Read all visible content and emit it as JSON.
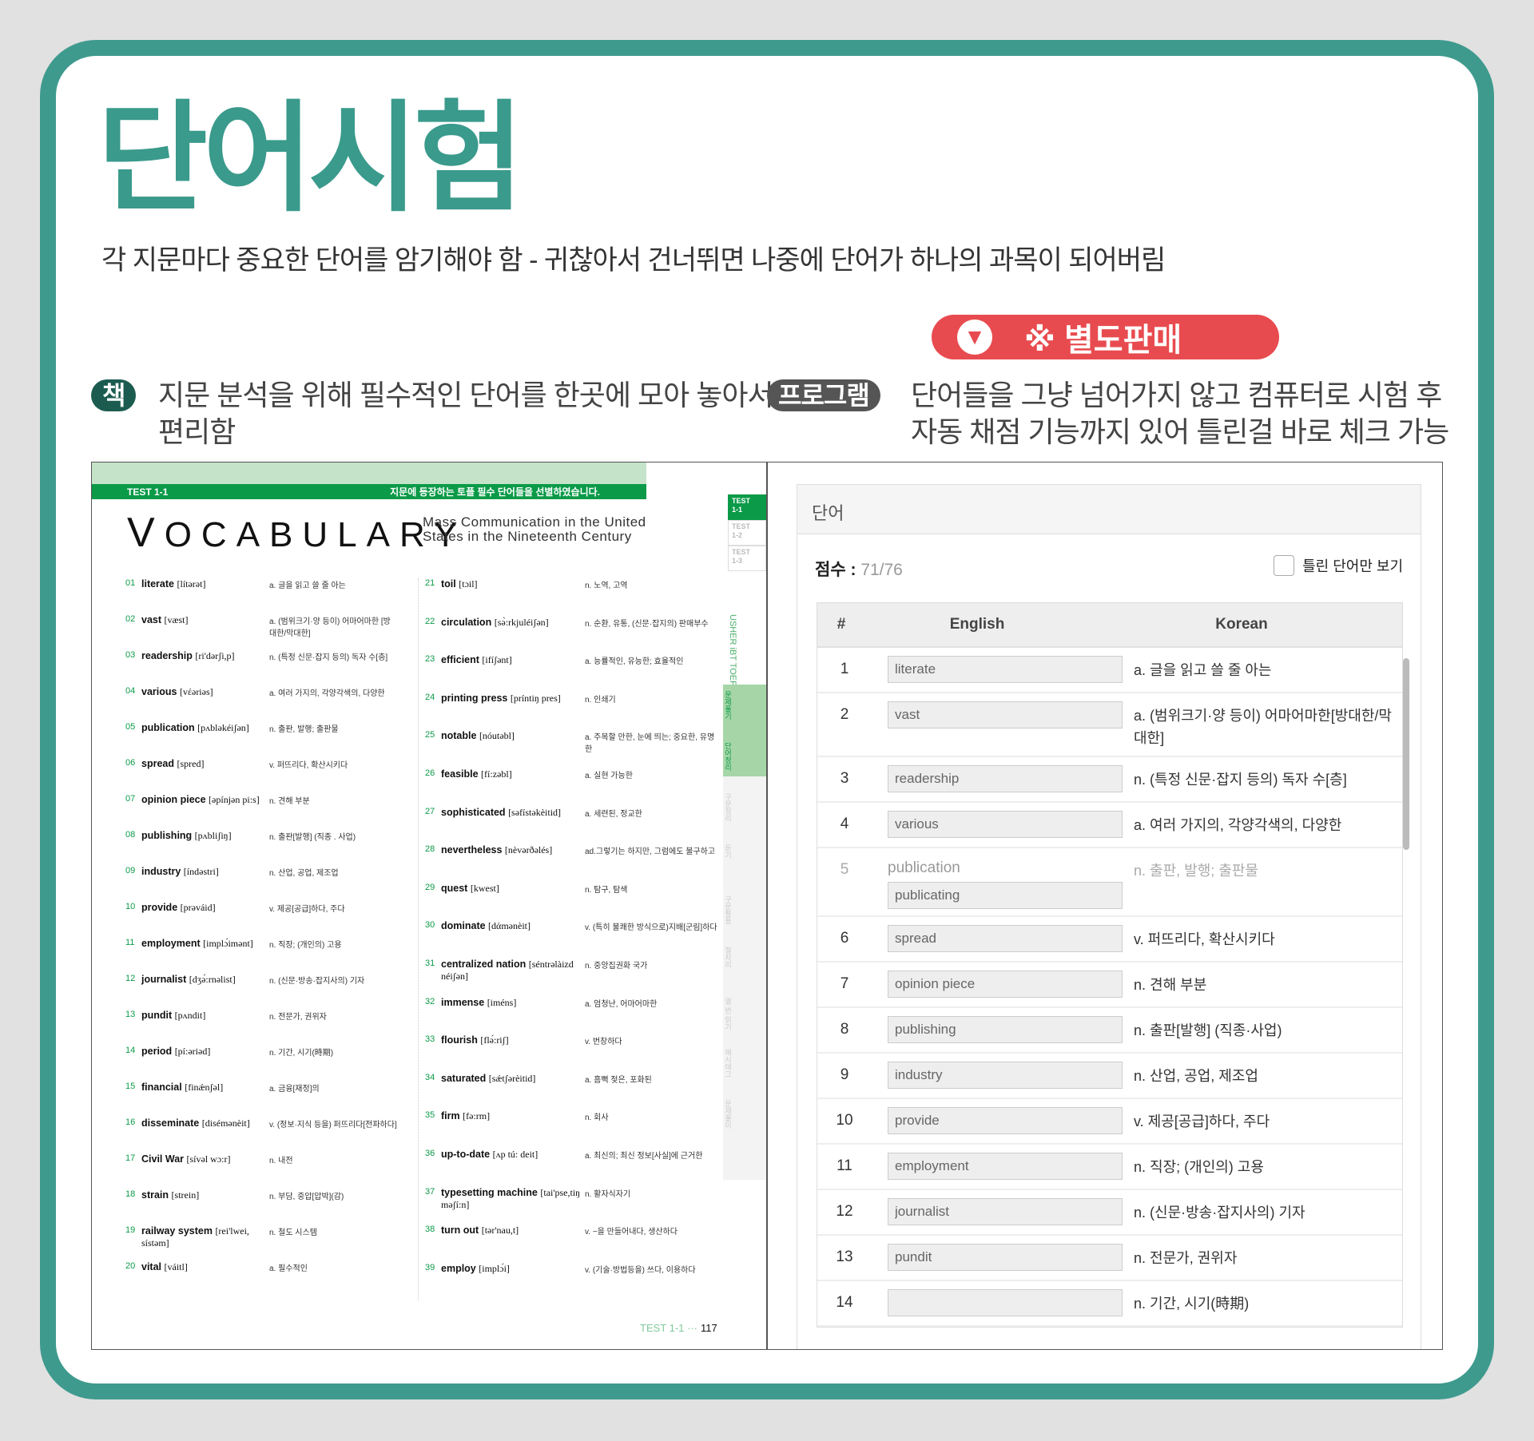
{
  "title": "단어시험",
  "subtitle": "각 지문마다 중요한 단어를 암기해야 함 - 귀찮아서 건너뛰면 나중에 단어가 하나의 과목이 되어버림",
  "sale_badge": {
    "label": "※ 별도판매",
    "icon": "down-arrow-icon",
    "color": "#e84b4f"
  },
  "book_desc": {
    "pill": "책",
    "text": "지문 분석을 위해 필수적인 단어를 한곳에 모아 놓아서 보기 편리함"
  },
  "program_desc": {
    "pill": "프로그램",
    "text": "단어들을 그냥 넘어가지 않고 컴퓨터로 시험 후 자동 채점 기능까지 있어 틀린걸 바로 체크 가능"
  },
  "book": {
    "band_left": "TEST 1-1",
    "band_right": "지문에 등장하는 토플 필수 단어들을 선별하였습니다.",
    "heading": "VOCABULARY",
    "passage_title": "Mass Communication in the United States in the Nineteenth Century",
    "tabs": [
      {
        "top": "TEST",
        "bottom": "1-1"
      },
      {
        "top": "TEST",
        "bottom": "1-2"
      },
      {
        "top": "TEST",
        "bottom": "1-3"
      }
    ],
    "series": "USHER iBT TOEFL BASIC READING",
    "steps": [
      "문제풀기",
      "단어정리",
      "구문정리",
      "듣기",
      "구문활용",
      "절차리",
      "열 번 읽기",
      "해시태그",
      "문제풀이"
    ],
    "footer_test": "TEST 1-1",
    "footer_page": "117",
    "col1": [
      {
        "n": "01",
        "w": "literate",
        "p": "[lítərət]",
        "m": "a. 글을 읽고 쓸 줄 아는"
      },
      {
        "n": "02",
        "w": "vast",
        "p": "[væst]",
        "m": "a. (범위크기·양 등이) 어마어마한 [방대한/막대한]"
      },
      {
        "n": "03",
        "w": "readership",
        "p": "[ri'dərʃi,p]",
        "m": "n. (특정 신문·잡지 등의) 독자 수[층]"
      },
      {
        "n": "04",
        "w": "various",
        "p": "[vέəriəs]",
        "m": "a. 여러 가지의, 각양각색의, 다양한"
      },
      {
        "n": "05",
        "w": "publication",
        "p": "[pʌbləkéiʃən]",
        "m": "n. 출판, 발행; 출판물"
      },
      {
        "n": "06",
        "w": "spread",
        "p": "[spred]",
        "m": "v. 퍼뜨리다, 확산시키다"
      },
      {
        "n": "07",
        "w": "opinion piece",
        "p": "[əpínjən pi:s]",
        "m": "n. 견해 부분"
      },
      {
        "n": "08",
        "w": "publishing",
        "p": "[pʌbliʃiŋ]",
        "m": "n. 출판[발행] (직종 . 사업)"
      },
      {
        "n": "09",
        "w": "industry",
        "p": "[índəstri]",
        "m": "n. 산업, 공업, 제조업"
      },
      {
        "n": "10",
        "w": "provide",
        "p": "[prəváid]",
        "m": "v. 제공[공급]하다, 주다"
      },
      {
        "n": "11",
        "w": "employment",
        "p": "[implɔ́imənt]",
        "m": "n. 직장; (개인의) 고용"
      },
      {
        "n": "12",
        "w": "journalist",
        "p": "[dʒə́:rnəlist]",
        "m": "n. (신문·방송·잡지사의) 기자"
      },
      {
        "n": "13",
        "w": "pundit",
        "p": "[pʌndit]",
        "m": "n. 전문가, 권위자"
      },
      {
        "n": "14",
        "w": "period",
        "p": "[pí:əriəd]",
        "m": "n. 기간, 시기(時期)"
      },
      {
        "n": "15",
        "w": "financial",
        "p": "[finǽnʃəl]",
        "m": "a. 금융[재정]의"
      },
      {
        "n": "16",
        "w": "disseminate",
        "p": "[disémənèit]",
        "m": "v. (정보·지식 등을) 퍼뜨리다[전파하다]"
      },
      {
        "n": "17",
        "w": "Civil War",
        "p": "[sívəl wɔ:r]",
        "m": "n. 내전"
      },
      {
        "n": "18",
        "w": "strain",
        "p": "[strein]",
        "m": "n. 부담, 중압[압박](감)"
      },
      {
        "n": "19",
        "w": "railway system",
        "p": "[rei'lwei, sístəm]",
        "m": "n. 철도 시스템"
      },
      {
        "n": "20",
        "w": "vital",
        "p": "[váitl]",
        "m": "a. 필수적인"
      }
    ],
    "col2": [
      {
        "n": "21",
        "w": "toil",
        "p": "[tɔil]",
        "m": "n. 노역, 고역"
      },
      {
        "n": "22",
        "w": "circulation",
        "p": "[sə̀:rkjuléiʃən]",
        "m": "n. 순환, 유통, (신문·잡지의) 판매부수"
      },
      {
        "n": "23",
        "w": "efficient",
        "p": "[ifíʃənt]",
        "m": "a. 능률적인, 유능한; 효율적인"
      },
      {
        "n": "24",
        "w": "printing press",
        "p": "[príntiŋ pres]",
        "m": "n. 인쇄기"
      },
      {
        "n": "25",
        "w": "notable",
        "p": "[nóutəbl]",
        "m": "a. 주목할 만한, 눈에 띄는; 중요한, 유명한"
      },
      {
        "n": "26",
        "w": "feasible",
        "p": "[fí:zəbl]",
        "m": "a. 실현 가능한"
      },
      {
        "n": "27",
        "w": "sophisticated",
        "p": "[səfístəkèitid]",
        "m": "a. 세련된, 정교한"
      },
      {
        "n": "28",
        "w": "nevertheless",
        "p": "[nèvərðəlés]",
        "m": "ad.그렇기는 하지만, 그럼에도 불구하고"
      },
      {
        "n": "29",
        "w": "quest",
        "p": "[kwest]",
        "m": "n. 탐구, 탐색"
      },
      {
        "n": "30",
        "w": "dominate",
        "p": "[dάmənèit]",
        "m": "v. (특히 불쾌한 방식으로)지배[군림]하다"
      },
      {
        "n": "31",
        "w": "centralized nation",
        "p": "[séntrəlàizd néiʃən]",
        "m": "n. 중앙집권화 국가"
      },
      {
        "n": "32",
        "w": "immense",
        "p": "[iméns]",
        "m": "a. 엄청난, 어마어마한"
      },
      {
        "n": "33",
        "w": "flourish",
        "p": "[flə́:riʃ]",
        "m": "v. 번창하다"
      },
      {
        "n": "34",
        "w": "saturated",
        "p": "[sǽtʃərèitid]",
        "m": "a. 흠뻑 젖은, 포화된"
      },
      {
        "n": "35",
        "w": "firm",
        "p": "[fə:rm]",
        "m": "n. 회사"
      },
      {
        "n": "36",
        "w": "up-to-date",
        "p": "[ʌp tú: deit]",
        "m": "a. 최신의; 최신 정보[사실]에 근거한"
      },
      {
        "n": "37",
        "w": "typesetting machine",
        "p": "[tai'pse,tiŋ məʃí:n]",
        "m": "n. 활자식자기"
      },
      {
        "n": "38",
        "w": "turn out",
        "p": "[tər'nau,t]",
        "m": "v. ~을 만들어내다, 생산하다"
      },
      {
        "n": "39",
        "w": "employ",
        "p": "[implɔ́i]",
        "m": "v. (기술·방법등을) 쓰다, 이용하다"
      }
    ]
  },
  "program": {
    "panel_title": "단어",
    "score_label": "점수 : ",
    "score_value": "71/76",
    "wrong_only_label": "틀린 단어만 보기",
    "wrong_only_checked": false,
    "headers": [
      "#",
      "English",
      "Korean"
    ],
    "rows": [
      {
        "num": "1",
        "value": "literate",
        "kor": "a. 글을 읽고 쓸 줄 아는"
      },
      {
        "num": "2",
        "value": "vast",
        "kor": "a. (범위크기·양 등이) 어마어마한[방대한/막대한]"
      },
      {
        "num": "3",
        "value": "readership",
        "kor": "n. (특정 신문·잡지 등의) 독자 수[층]"
      },
      {
        "num": "4",
        "value": "various",
        "kor": "a. 여러 가지의, 각양각색의, 다양한"
      },
      {
        "num": "5",
        "correct": "publication",
        "value": "publicating",
        "kor": "n. 출판, 발행; 출판물",
        "wrong": true
      },
      {
        "num": "6",
        "value": "spread",
        "kor": "v. 퍼뜨리다, 확산시키다"
      },
      {
        "num": "7",
        "value": "opinion piece",
        "kor": "n. 견해 부분"
      },
      {
        "num": "8",
        "value": "publishing",
        "kor": "n. 출판[발행] (직종·사업)"
      },
      {
        "num": "9",
        "value": "industry",
        "kor": "n. 산업, 공업, 제조업"
      },
      {
        "num": "10",
        "value": "provide",
        "kor": "v. 제공[공급]하다, 주다"
      },
      {
        "num": "11",
        "value": "employment",
        "kor": "n. 직장; (개인의) 고용"
      },
      {
        "num": "12",
        "value": "journalist",
        "kor": "n. (신문·방송·잡지사의) 기자"
      },
      {
        "num": "13",
        "value": "pundit",
        "kor": "n. 전문가, 권위자"
      },
      {
        "num": "14",
        "value": "",
        "kor": "n. 기간, 시기(時期)"
      }
    ]
  }
}
